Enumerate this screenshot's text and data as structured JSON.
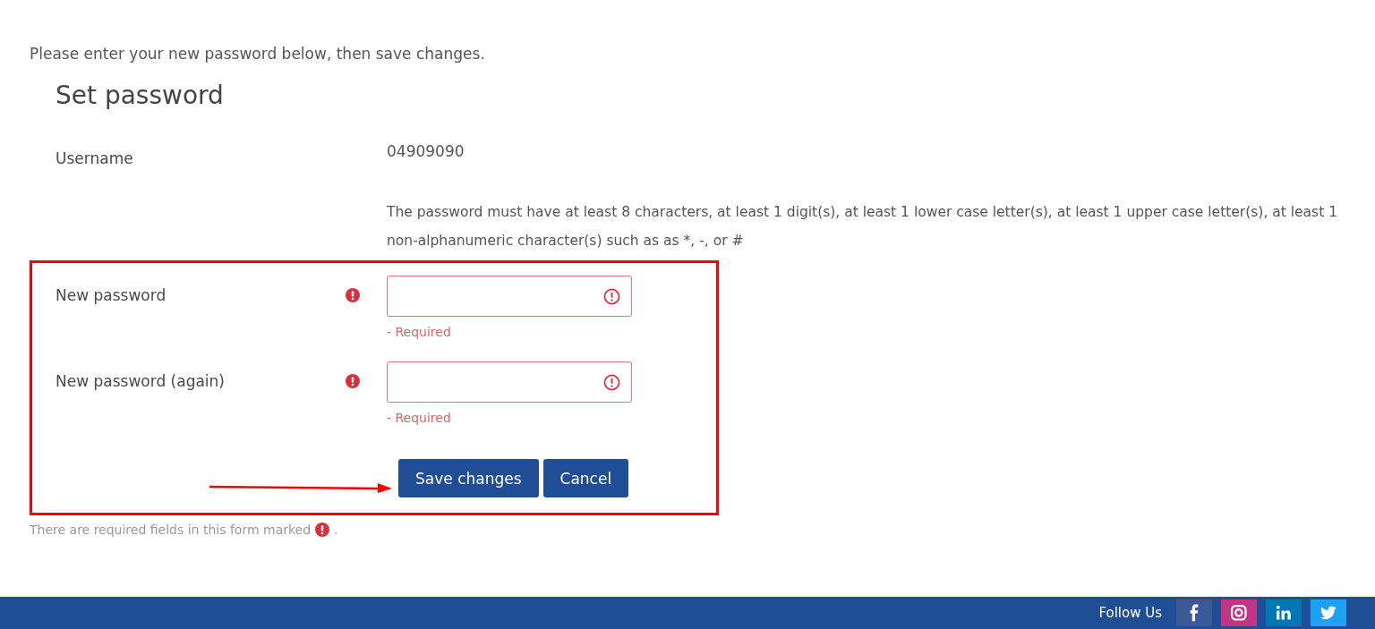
{
  "intro": "Please enter your new password below, then save changes.",
  "form": {
    "title": "Set password",
    "username": {
      "label": "Username",
      "value": "04909090"
    },
    "policy": "The password must have at least 8 characters, at least 1 digit(s), at least 1 lower case letter(s), at least 1 upper case letter(s), at least 1 non-alphanumeric character(s) such as as *, -, or #",
    "fields": [
      {
        "label": "New password",
        "required": true,
        "invalid": true,
        "error": "- Required"
      },
      {
        "label": "New password (again)",
        "required": true,
        "invalid": true,
        "error": "- Required"
      }
    ],
    "buttons": [
      "Save changes",
      "Cancel"
    ]
  },
  "required_note": {
    "text": "There are required fields in this form marked",
    "suffix": "."
  },
  "footer": {
    "follow_label": "Follow Us",
    "social": [
      {
        "kind": "facebook",
        "color": "#3b5998"
      },
      {
        "kind": "instagram",
        "color": "#c13584"
      },
      {
        "kind": "linkedin",
        "color": "#0077b5"
      },
      {
        "kind": "twitter",
        "color": "#1da1f2"
      }
    ]
  }
}
